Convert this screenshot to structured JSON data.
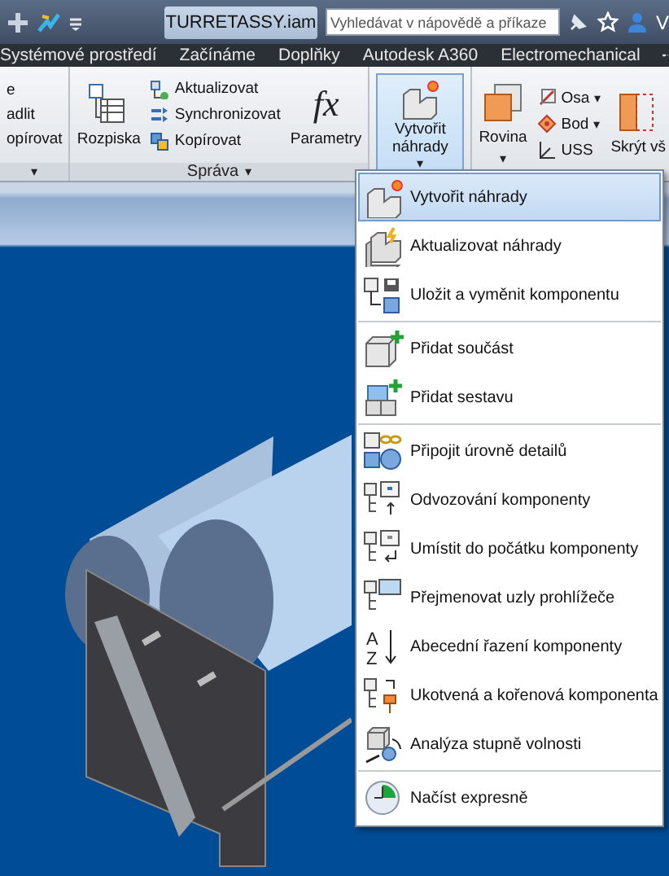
{
  "title_bar": {
    "title": "TURRETASSY.iam",
    "search": {
      "placeholder": "Vyhledávat v nápovědě a příkaze"
    },
    "user": "V"
  },
  "tabs": [
    {
      "label": "Systémové prostředí",
      "selected": false
    },
    {
      "label": "Začínáme",
      "selected": false
    },
    {
      "label": "Doplňky",
      "selected": false
    },
    {
      "label": "Autodesk A360",
      "selected": false
    },
    {
      "label": "Electromechanical",
      "selected": false
    }
  ],
  "ribbon": {
    "panels": [
      {
        "caret": "▾",
        "items": [
          {
            "kind": "small",
            "label": "e"
          },
          {
            "kind": "small",
            "label": "adlit"
          },
          {
            "kind": "small",
            "label": "opírovat"
          }
        ]
      },
      {
        "label": "Správa",
        "caret": "▾",
        "items": [
          {
            "kind": "large",
            "label": "Rozpiska"
          },
          {
            "kind": "small",
            "label": "Aktualizovat"
          },
          {
            "kind": "small",
            "label": "Synchronizovat"
          },
          {
            "kind": "small",
            "label": "Kopírovat"
          },
          {
            "kind": "large",
            "label": "Parametry",
            "symbol": "fx"
          }
        ]
      },
      {
        "items": [
          {
            "kind": "split",
            "label": "Vytvořit náhrady",
            "caret": "▾",
            "selected": true
          }
        ]
      },
      {
        "items": [
          {
            "kind": "large",
            "label": "Rovina",
            "caret": "▾"
          },
          {
            "kind": "small",
            "label": "Osa",
            "caret": "▾"
          },
          {
            "kind": "small",
            "label": "Bod",
            "caret": "▾"
          },
          {
            "kind": "small",
            "label": "USS"
          },
          {
            "kind": "large",
            "label": "Skrýt vš"
          }
        ]
      }
    ]
  },
  "menu": {
    "groups": [
      [
        {
          "label": "Vytvořit náhrady",
          "selected": true
        },
        {
          "label": "Aktualizovat náhrady",
          "selected": false
        },
        {
          "label": "Uložit a vyměnit komponentu",
          "selected": false
        }
      ],
      [
        {
          "label": "Přidat součást",
          "selected": false
        },
        {
          "label": "Přidat sestavu",
          "selected": false
        }
      ],
      [
        {
          "label": "Připojit úrovně detailů",
          "selected": false
        },
        {
          "label": "Odvozování komponenty",
          "selected": false
        },
        {
          "label": "Umístit do počátku komponenty",
          "selected": false
        },
        {
          "label": "Přejmenovat uzly prohlížeče",
          "selected": false
        },
        {
          "label": "Abecední řazení komponenty",
          "selected": false,
          "icon_letters": [
            "A",
            "Z"
          ]
        },
        {
          "label": "Ukotvená a kořenová komponenta",
          "selected": false
        },
        {
          "label": "Analýza stupně volnosti",
          "selected": false
        }
      ],
      [
        {
          "label": "Načíst expresně",
          "selected": false
        }
      ]
    ]
  }
}
